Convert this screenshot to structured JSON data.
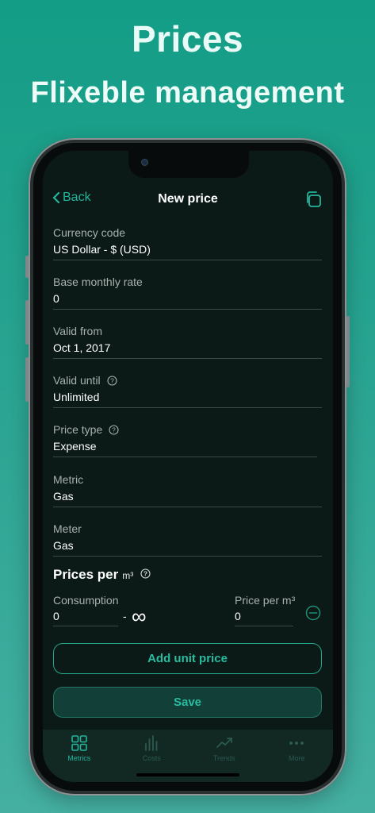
{
  "promo": {
    "title": "Prices",
    "subtitle": "Flixeble management"
  },
  "nav": {
    "back_label": "Back",
    "title": "New price"
  },
  "fields": [
    {
      "label": "Currency code",
      "value": "US Dollar - $ (USD)",
      "has_help": false
    },
    {
      "label": "Base monthly rate",
      "value": "0",
      "has_help": false
    },
    {
      "label": "Valid from",
      "value": "Oct 1, 2017",
      "has_help": false
    },
    {
      "label": "Valid until",
      "value": "Unlimited",
      "has_help": true
    },
    {
      "label": "Price type",
      "value": "Expense",
      "has_help": true
    },
    {
      "label": "Metric",
      "value": "Gas",
      "has_help": false
    },
    {
      "label": "Meter",
      "value": "Gas",
      "has_help": false
    }
  ],
  "prices_section": {
    "title": "Prices per",
    "unit": "m³",
    "consumption_label": "Consumption",
    "consumption_value": "0",
    "separator": "-",
    "upper_bound": "∞",
    "price_label": "Price per m³",
    "price_value": "0"
  },
  "buttons": {
    "add_unit_price": "Add unit price",
    "save": "Save"
  },
  "tabbar": [
    {
      "label": "Metrics",
      "icon": "grid-icon",
      "active": true
    },
    {
      "label": "Costs",
      "icon": "bar-chart-icon",
      "active": false
    },
    {
      "label": "Trends",
      "icon": "trend-line-icon",
      "active": false
    },
    {
      "label": "More",
      "icon": "more-dots-icon",
      "active": false
    }
  ],
  "colors": {
    "accent": "#22b59b",
    "background_gradient_top": "#139d86",
    "screen_bg": "#0c1a17"
  }
}
